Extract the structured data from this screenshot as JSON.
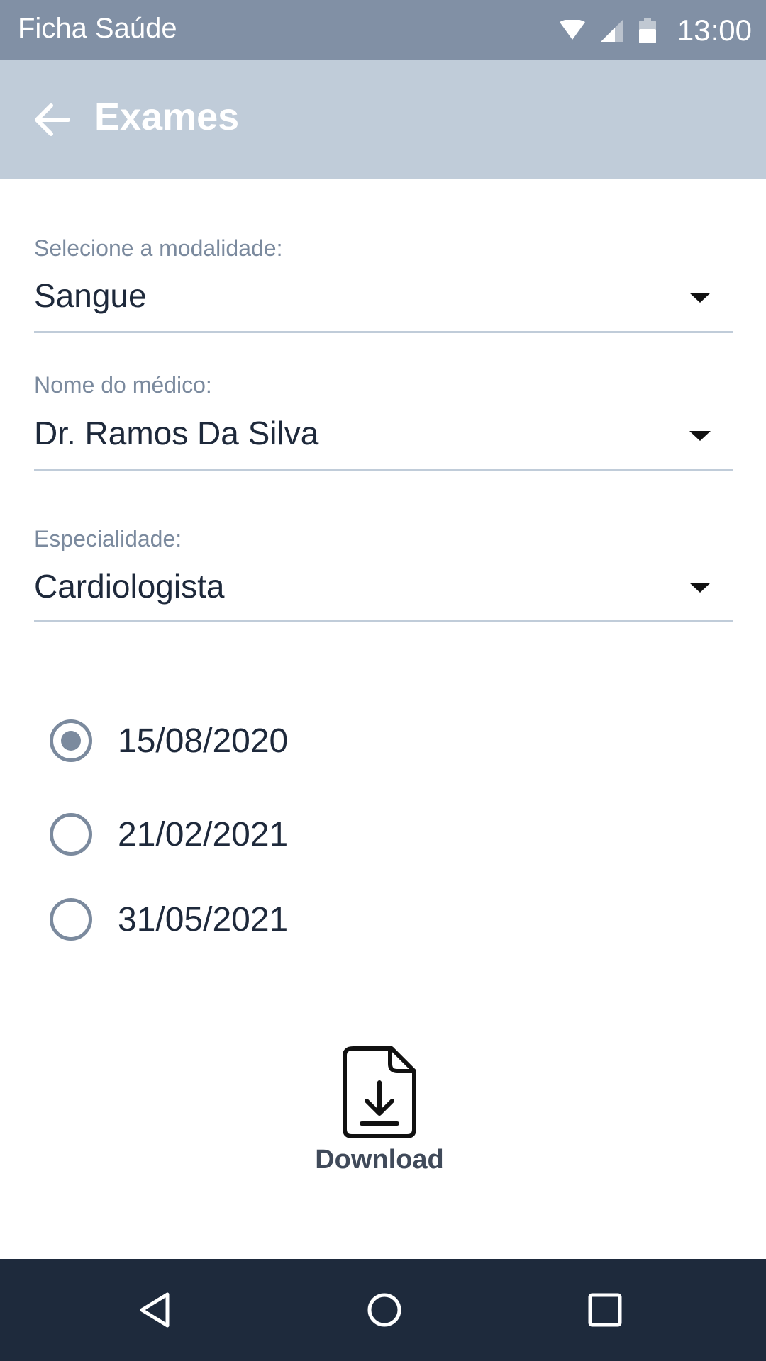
{
  "status_bar": {
    "app_name": "Ficha Saúde",
    "time": "13:00",
    "icons": [
      "wifi-icon",
      "cellular-signal-icon",
      "battery-icon"
    ]
  },
  "app_bar": {
    "back_icon": "arrow-left-icon",
    "title": "Exames"
  },
  "form": {
    "modality": {
      "label": "Selecione a modalidade:",
      "value": "Sangue"
    },
    "doctor": {
      "label": "Nome do médico:",
      "value": "Dr. Ramos Da Silva"
    },
    "specialty": {
      "label": "Especialidade:",
      "value": "Cardiologista"
    }
  },
  "dates": [
    {
      "label": "15/08/2020",
      "selected": true
    },
    {
      "label": "21/02/2021",
      "selected": false
    },
    {
      "label": "31/05/2021",
      "selected": false
    }
  ],
  "download": {
    "label": "Download",
    "icon": "file-download-icon"
  },
  "nav_bar": {
    "icons": [
      "nav-back-icon",
      "nav-home-icon",
      "nav-recents-icon"
    ]
  },
  "colors": {
    "status_bar": "#8190a5",
    "app_bar": "#c0ccd9",
    "label_text": "#7b8a9e",
    "value_text": "#1e293b",
    "nav_bar": "#1e2a3c"
  }
}
